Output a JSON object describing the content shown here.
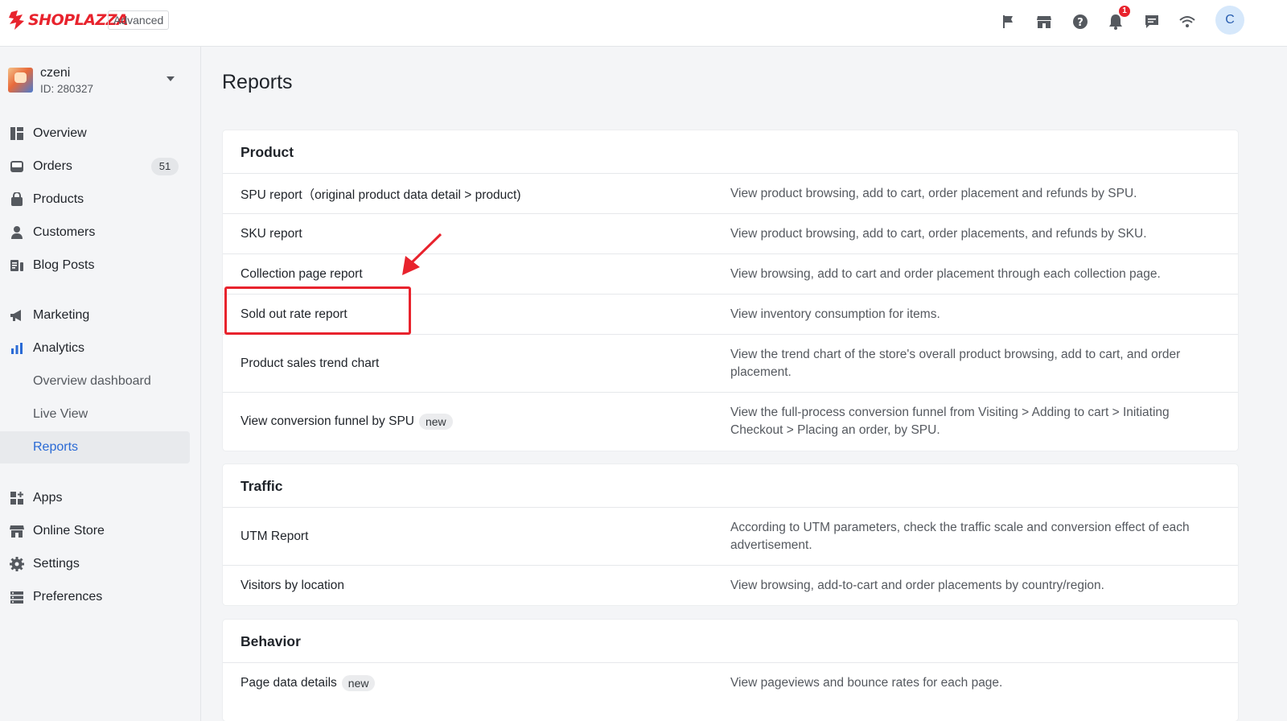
{
  "brand": {
    "name": "SHOPLAZZA",
    "plan": "Advanced",
    "accent": "#e8232d"
  },
  "topbar": {
    "icons": [
      "flag-icon",
      "store-icon",
      "help-icon",
      "bell-icon",
      "chat-icon",
      "wifi-icon"
    ],
    "notification_count": "1",
    "avatar_initial": "C"
  },
  "account": {
    "name": "czeni",
    "id": "ID: 280327"
  },
  "sidebar": {
    "items": [
      {
        "label": "Overview",
        "icon": "overview-icon"
      },
      {
        "label": "Orders",
        "icon": "orders-icon",
        "badge": "51"
      },
      {
        "label": "Products",
        "icon": "products-icon"
      },
      {
        "label": "Customers",
        "icon": "customers-icon"
      },
      {
        "label": "Blog Posts",
        "icon": "blog-icon"
      },
      {
        "label": "Marketing",
        "icon": "marketing-icon"
      },
      {
        "label": "Analytics",
        "icon": "analytics-icon"
      },
      {
        "label": "Apps",
        "icon": "apps-icon"
      },
      {
        "label": "Online Store",
        "icon": "online-store-icon"
      },
      {
        "label": "Settings",
        "icon": "settings-icon"
      },
      {
        "label": "Preferences",
        "icon": "preferences-icon"
      }
    ],
    "analytics_sub": [
      "Overview dashboard",
      "Live View",
      "Reports"
    ],
    "active_sub": "Reports",
    "active_color": "#2a6ad5"
  },
  "page": {
    "title": "Reports"
  },
  "sections": [
    {
      "title": "Product",
      "rows": [
        {
          "name": "SPU report（original product data detail > product)",
          "desc": "View product browsing, add to cart, order placement and refunds by SPU."
        },
        {
          "name": "SKU report",
          "desc": "View product browsing, add to cart, order placements, and refunds by SKU."
        },
        {
          "name": "Collection page report",
          "desc": "View browsing, add to cart and order placement through each collection page."
        },
        {
          "name": "Sold out rate report",
          "desc": "View inventory consumption for items."
        },
        {
          "name": "Product sales trend chart",
          "desc": "View the trend chart of the store's overall product browsing, add to cart, and order placement."
        },
        {
          "name": "View conversion funnel by SPU",
          "badge": "new",
          "desc": "View the full-process conversion funnel from Visiting > Adding to cart > Initiating Checkout > Placing an order, by SPU."
        }
      ]
    },
    {
      "title": "Traffic",
      "rows": [
        {
          "name": "UTM Report",
          "desc": "According to UTM parameters, check the traffic scale and conversion effect of each advertisement."
        },
        {
          "name": "Visitors by location",
          "desc": "View browsing, add-to-cart and order placements by country/region."
        }
      ]
    },
    {
      "title": "Behavior",
      "rows": [
        {
          "name": "Page data details",
          "badge": "new",
          "desc": "View pageviews and bounce rates for each page."
        }
      ]
    }
  ],
  "annotation": {
    "highlighted_row": "Sold out rate report",
    "color": "#e8232d"
  }
}
